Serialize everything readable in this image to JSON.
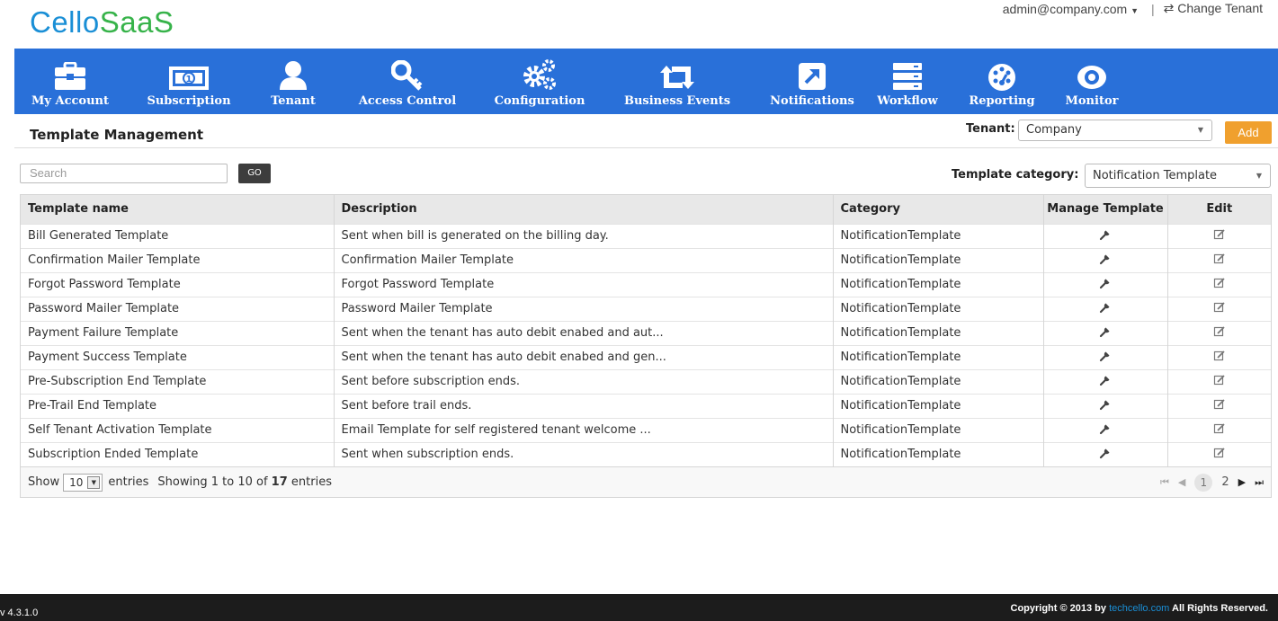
{
  "brand": {
    "part1": "Cello",
    "part2": "SaaS"
  },
  "user": {
    "email": "admin@company.com",
    "caret": "▼",
    "separator": "|",
    "change_icon": "⇄",
    "change_label": "Change Tenant"
  },
  "nav": [
    {
      "label": "My Account",
      "icon": "briefcase-icon"
    },
    {
      "label": "Subscription",
      "icon": "banknote-icon"
    },
    {
      "label": "Tenant",
      "icon": "user-icon"
    },
    {
      "label": "Access Control",
      "icon": "key-icon"
    },
    {
      "label": "Configuration",
      "icon": "gears-icon"
    },
    {
      "label": "Business Events",
      "icon": "retweet-icon"
    },
    {
      "label": "Notifications",
      "icon": "external-link-icon"
    },
    {
      "label": "Workflow",
      "icon": "server-icon"
    },
    {
      "label": "Reporting",
      "icon": "dashboard-icon"
    },
    {
      "label": "Monitor",
      "icon": "eye-icon"
    }
  ],
  "page": {
    "title": "Template Management"
  },
  "tenant": {
    "label": "Tenant:",
    "value": "Company",
    "caret": "▼"
  },
  "add_label": "Add",
  "search": {
    "placeholder": "Search",
    "go_label": "GO"
  },
  "category": {
    "label": "Template category:",
    "value": "Notification Template",
    "caret": "▼"
  },
  "table": {
    "headers": [
      "Template name",
      "Description",
      "Category",
      "Manage Template",
      "Edit"
    ],
    "rows": [
      [
        "Bill Generated Template",
        "Sent when bill is generated on the billing day.",
        "NotificationTemplate"
      ],
      [
        "Confirmation Mailer Template",
        "Confirmation Mailer Template",
        "NotificationTemplate"
      ],
      [
        "Forgot Password Template",
        "Forgot Password Template",
        "NotificationTemplate"
      ],
      [
        "Password Mailer Template",
        "Password Mailer Template",
        "NotificationTemplate"
      ],
      [
        "Payment Failure Template",
        "Sent when the tenant has auto debit enabed and aut...",
        "NotificationTemplate"
      ],
      [
        "Payment Success Template",
        "Sent when the tenant has auto debit enabed and gen...",
        "NotificationTemplate"
      ],
      [
        "Pre-Subscription End Template",
        "Sent before subscription ends.",
        "NotificationTemplate"
      ],
      [
        "Pre-Trail End Template",
        "Sent before trail ends.",
        "NotificationTemplate"
      ],
      [
        "Self Tenant Activation Template",
        "Email Template for self registered tenant welcome ...",
        "NotificationTemplate"
      ],
      [
        "Subscription Ended Template",
        "Sent when subscription ends.",
        "NotificationTemplate"
      ]
    ],
    "manage_icon": "wrench-icon",
    "edit_icon": "edit-icon"
  },
  "paging": {
    "show_label": "Show",
    "page_size": "10",
    "entries_label": "entries",
    "info_prefix": "Showing 1 to 10 of",
    "info_total": "17",
    "info_suffix": "entries",
    "pages": [
      "1",
      "2"
    ],
    "first_glyph": "⏮",
    "prev_glyph": "◀",
    "next_glyph": "▶",
    "last_glyph": "⏭"
  },
  "footer": {
    "version": "v 4.3.1.0",
    "copyright_prefix": "Copyright © 2013 by",
    "brand_link": "techcello.com",
    "copyright_suffix": "All Rights Reserved."
  },
  "colors": {
    "nav_bg": "#2970d9",
    "logo_blue": "#1a8fd6",
    "logo_green": "#37b34a",
    "add_btn": "#f0a02e",
    "footer_bg": "#1c1c1c"
  }
}
